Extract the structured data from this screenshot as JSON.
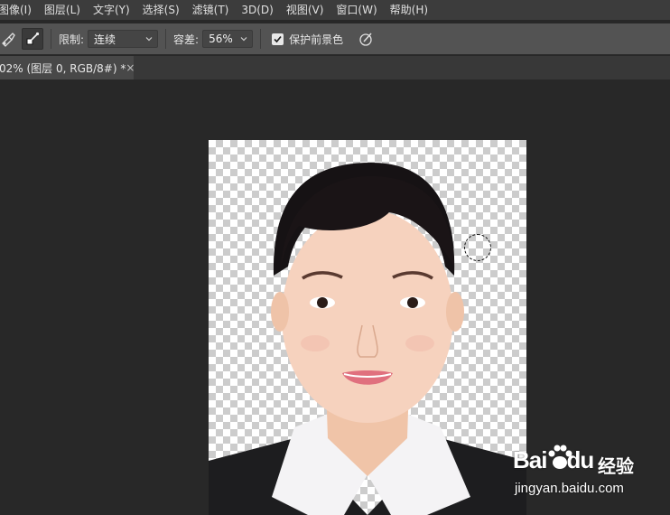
{
  "menubar": {
    "items": [
      "图像(I)",
      "图层(L)",
      "文字(Y)",
      "选择(S)",
      "滤镜(T)",
      "3D(D)",
      "视图(V)",
      "窗口(W)",
      "帮助(H)"
    ]
  },
  "options": {
    "limit_label": "限制:",
    "limit_value": "连续",
    "tolerance_label": "容差:",
    "tolerance_value": "56%",
    "protect_label": "保护前景色",
    "protect_checked": true
  },
  "document_tab": {
    "title": "02% (图层 0, RGB/8#) *",
    "close": "×"
  },
  "watermark": {
    "brand": "Bai",
    "brand_tail": "du",
    "cn": "经验",
    "url": "jingyan.baidu.com"
  },
  "icons": {
    "tool_brush": "background-eraser-icon",
    "tool_sampling": "sampling-icon",
    "pressure": "pen-pressure-icon",
    "paw": "baidu-paw-icon"
  }
}
